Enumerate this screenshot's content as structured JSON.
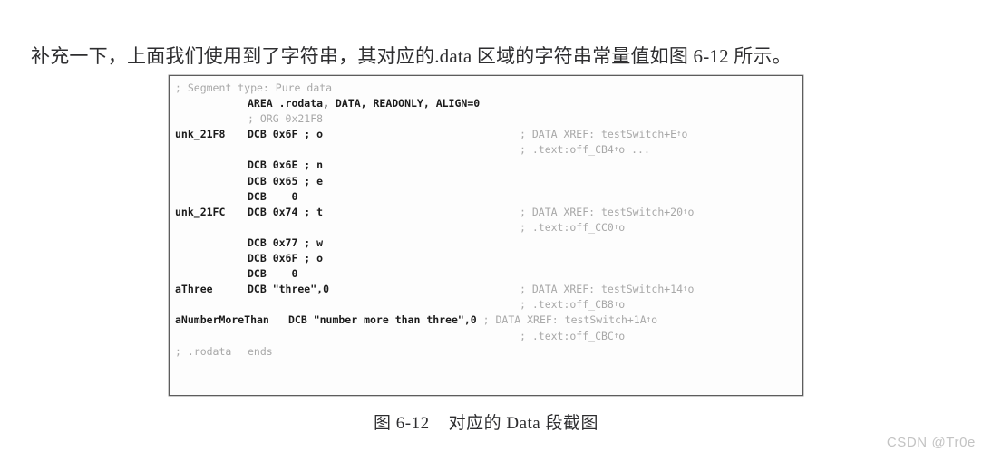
{
  "intro": {
    "paragraph": "补充一下，上面我们使用到了字符串，其对应的.data 区域的字符串常量值如图 6-12 所示。"
  },
  "figure": {
    "caption": "图 6-12    对应的 Data 段截图",
    "border_color": "#5d5d5d",
    "background_color": "#fdfdfd",
    "code_color": "#1b1b1b",
    "comment_color": "#a8a8a8",
    "code_lines": [
      {
        "label": "; Segment type: Pure data",
        "label_style": "comment",
        "instr": "",
        "xref": ""
      },
      {
        "label": "",
        "instr": "AREA .rodata, DATA, READONLY, ALIGN=0",
        "instr_style": "bold",
        "xref": ""
      },
      {
        "label": "",
        "instr": "; ORG 0x21F8",
        "instr_style": "comment",
        "xref": ""
      },
      {
        "label": "unk_21F8",
        "label_style": "bold",
        "instr": "DCB 0x6F ; o",
        "instr_style": "bold",
        "xref": "; DATA XREF: testSwitch+E↑o"
      },
      {
        "label": "",
        "instr": "",
        "xref": "; .text:off_CB4↑o ..."
      },
      {
        "label": "",
        "instr": "DCB 0x6E ; n",
        "instr_style": "bold",
        "xref": ""
      },
      {
        "label": "",
        "instr": "DCB 0x65 ; e",
        "instr_style": "bold",
        "xref": ""
      },
      {
        "label": "",
        "instr": "DCB    0",
        "instr_style": "bold",
        "xref": ""
      },
      {
        "label": "unk_21FC",
        "label_style": "bold",
        "instr": "DCB 0x74 ; t",
        "instr_style": "bold",
        "xref": "; DATA XREF: testSwitch+20↑o"
      },
      {
        "label": "",
        "instr": "",
        "xref": "; .text:off_CC0↑o"
      },
      {
        "label": "",
        "instr": "DCB 0x77 ; w",
        "instr_style": "bold",
        "xref": ""
      },
      {
        "label": "",
        "instr": "DCB 0x6F ; o",
        "instr_style": "bold",
        "xref": ""
      },
      {
        "label": "",
        "instr": "DCB    0",
        "instr_style": "bold",
        "xref": ""
      },
      {
        "label": "aThree",
        "label_style": "bold",
        "instr": "DCB \"three\",0",
        "instr_style": "bold",
        "xref": "; DATA XREF: testSwitch+14↑o"
      },
      {
        "label": "",
        "instr": "",
        "xref": "; .text:off_CB8↑o"
      },
      {
        "label": "aNumberMoreThan",
        "label_style": "bold",
        "inline_instr": "DCB \"number more than three\",0 ; DATA XREF: testSwitch+1A↑o",
        "instr": "",
        "xref": ""
      },
      {
        "label": "",
        "instr": "",
        "xref": "; .text:off_CBC↑o"
      },
      {
        "label": "; .rodata",
        "label_style": "comment",
        "instr": "ends",
        "instr_style": "comment",
        "xref": ""
      }
    ]
  },
  "watermark": {
    "text": "CSDN @Tr0e"
  }
}
